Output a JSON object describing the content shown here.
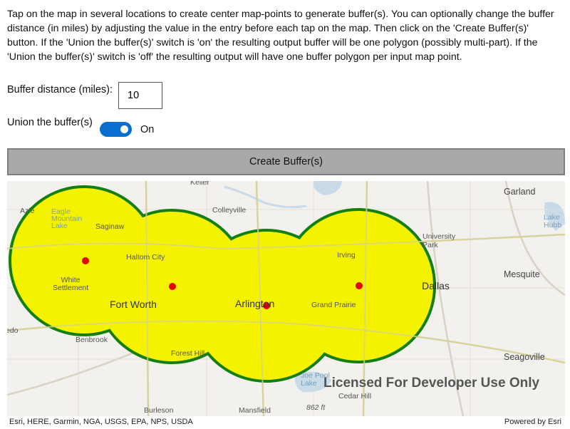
{
  "instructions": "Tap on the map in several locations to create center map-points to generate buffer(s). You can optionally change the buffer distance (in miles) by adjusting the value in the entry before each tap on the map. Then click on the 'Create Buffer(s)' button. If the 'Union the buffer(s)' switch is 'on' the resulting output buffer will be one polygon (possibly multi-part). If the 'Union the buffer(s)' switch is 'off' the resulting output will have one buffer polygon per input map point.",
  "buffer": {
    "label": "Buffer distance (miles):",
    "value": "10"
  },
  "union": {
    "label": "Union the buffer(s)",
    "state": "On",
    "enabled": true
  },
  "create_button": "Create Buffer(s)",
  "map": {
    "labels": {
      "keller": "Keller",
      "garland": "Garland",
      "colleyville": "Colleyville",
      "saginaw": "Saginaw",
      "haltom_city": "Haltom City",
      "university_park": "University\nPark",
      "mesquite": "Mesquite",
      "white_settlement": "White\nSettlement",
      "dallas": "Dallas",
      "fort_worth": "Fort Worth",
      "arlington": "Arlington",
      "grand_prairie": "Grand Prairie",
      "irving": "Irving",
      "benbrook": "Benbrook",
      "forest_hill": "Forest Hill",
      "seagoville": "Seagoville",
      "cedar_hill": "Cedar Hill",
      "burleson": "Burleson",
      "mansfield": "Mansfield",
      "lake_hubbard": "Lake\nHubb",
      "eagle_mountain": "Eagle\nMountain\nLake",
      "joe_pool": "Joe Pool\nLake",
      "elev": "862 ft",
      "azle": "Azle",
      "aledo": "edo"
    },
    "watermark": "Licensed For Developer Use Only",
    "attribution_left": "Esri, HERE, Garmin, NGA, USGS, EPA, NPS, USDA",
    "attribution_right": "Powered by Esri",
    "colors": {
      "buffer_fill": "#f5f200",
      "buffer_outline": "#157f0e",
      "point": "#e60000"
    }
  }
}
